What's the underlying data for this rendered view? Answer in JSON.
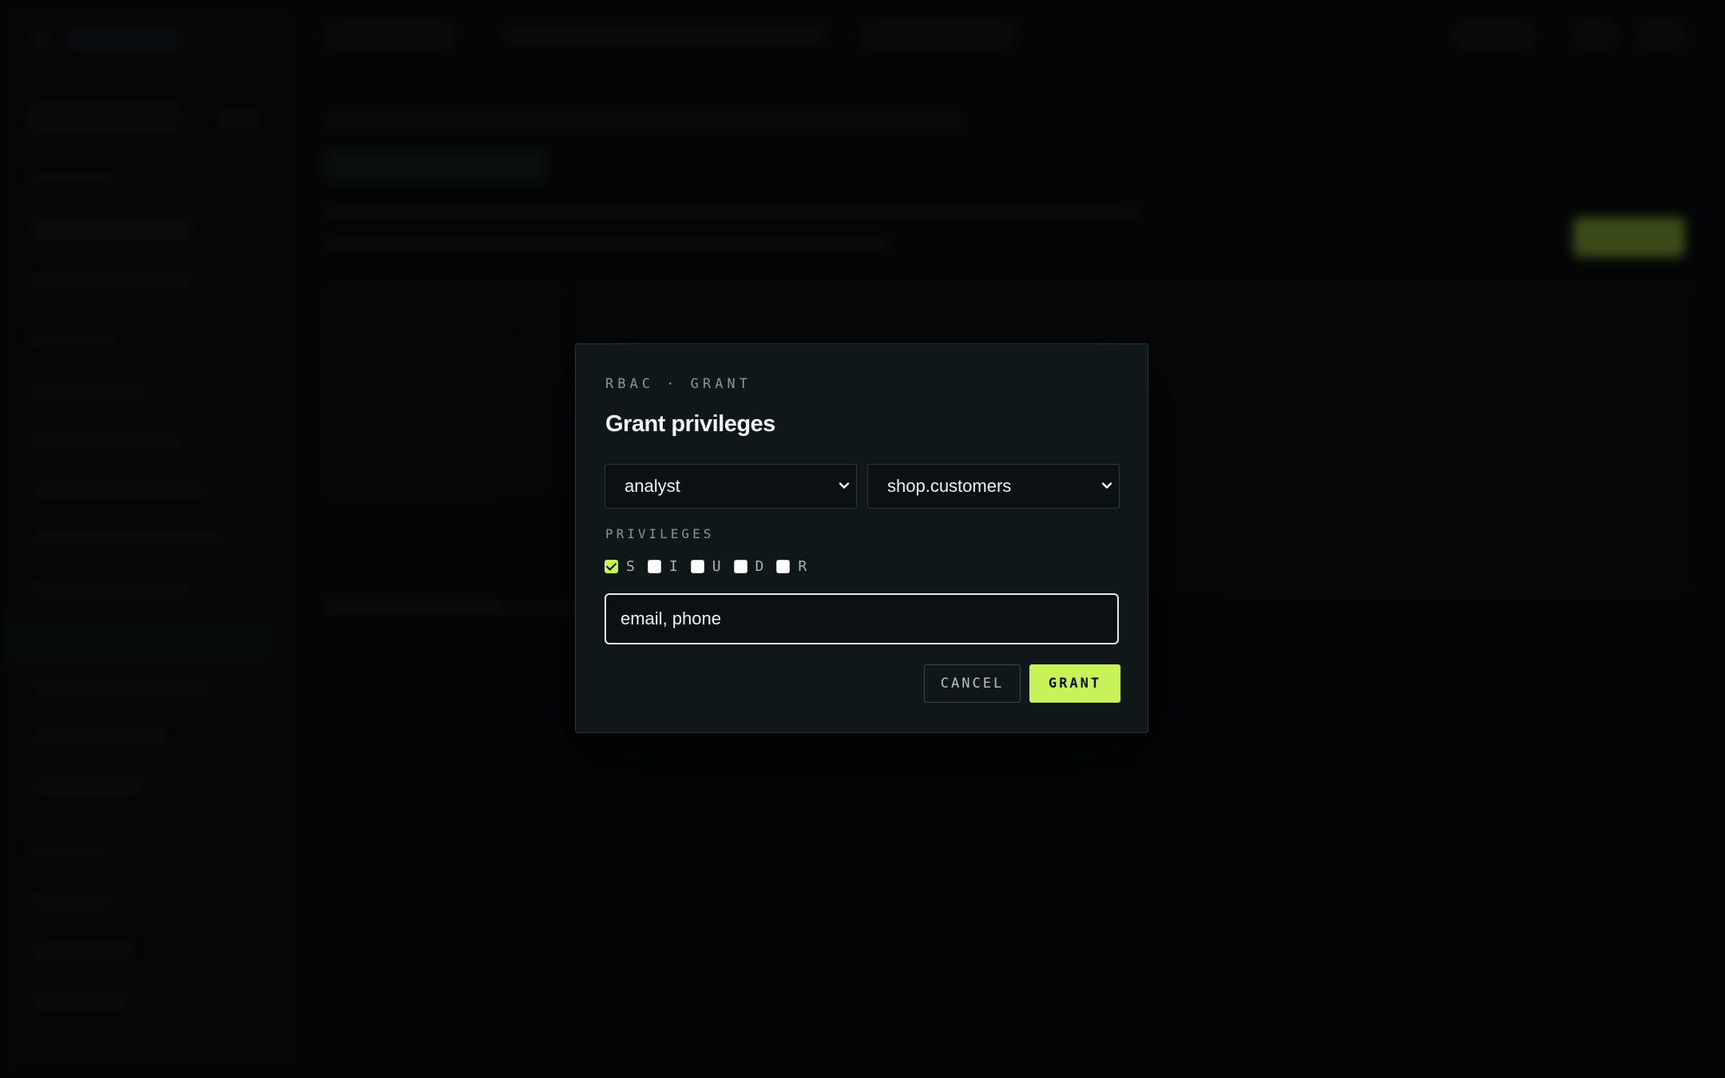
{
  "dialog": {
    "eyebrow": "RBAC · GRANT",
    "title": "Grant privileges",
    "role_select": {
      "value": "analyst"
    },
    "table_select": {
      "value": "shop.customers"
    },
    "privileges_label": "PRIVILEGES",
    "privileges": [
      {
        "label": "S",
        "checked": true
      },
      {
        "label": "I",
        "checked": false
      },
      {
        "label": "U",
        "checked": false
      },
      {
        "label": "D",
        "checked": false
      },
      {
        "label": "R",
        "checked": false
      }
    ],
    "columns_input": {
      "value": "email, phone"
    },
    "cancel_label": "CANCEL",
    "grant_label": "GRANT"
  },
  "colors": {
    "accent": "#c7f25a",
    "modal_bg": "#101719",
    "backdrop": "#070a0c"
  }
}
